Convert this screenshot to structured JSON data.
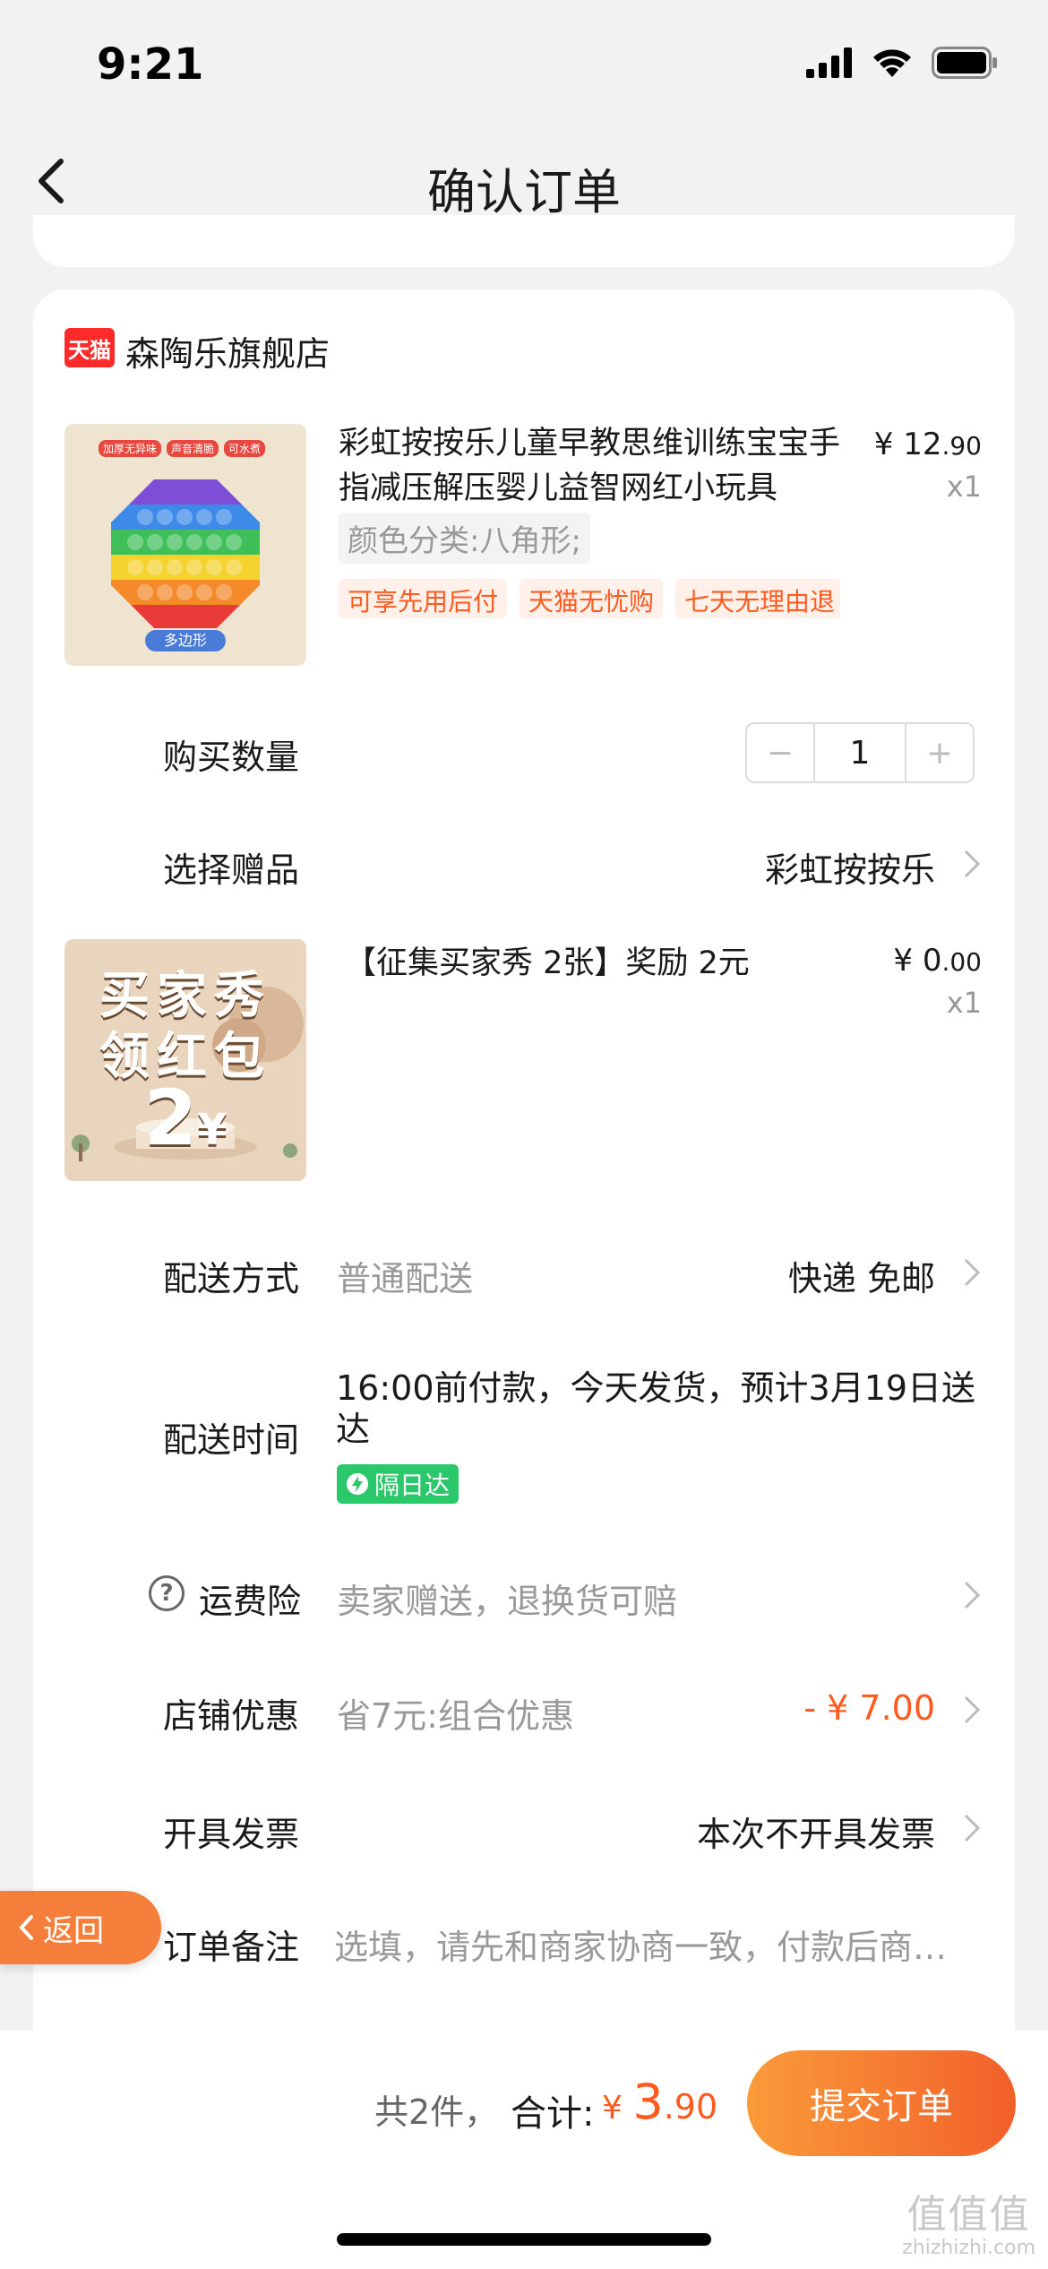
{
  "status": {
    "time": "9:21"
  },
  "nav": {
    "title": "确认订单"
  },
  "shop": {
    "logo_text": "天猫",
    "name": "森陶乐旗舰店"
  },
  "product": {
    "title": "彩虹按按乐儿童早教思维训练宝宝手指减压解压婴儿益智网红小玩具",
    "price_currency": "¥ ",
    "price_main": "12",
    "price_decimal": ".90",
    "qty": "x1",
    "variant": "颜色分类:八角形;",
    "tags": [
      "可享先用后付",
      "天猫无忧购",
      "七天无理由退"
    ],
    "image_labels": [
      "加厚无异味",
      "声音清脆",
      "可水煮"
    ],
    "image_caption": "多边形"
  },
  "quantity": {
    "label": "购买数量",
    "minus": "−",
    "value": "1",
    "plus": "+"
  },
  "gift_select": {
    "label": "选择赠品",
    "value": "彩虹按按乐"
  },
  "gift": {
    "title": "【征集买家秀 2张】奖励 2元",
    "price_currency": "¥ ",
    "price_main": "0",
    "price_decimal": ".00",
    "qty": "x1",
    "image_line1": "买家秀",
    "image_line2": "领红包",
    "image_amount": "2",
    "image_yen": "¥"
  },
  "delivery": {
    "label": "配送方式",
    "sub": "普通配送",
    "value": "快递 免邮"
  },
  "delivery_time": {
    "label": "配送时间",
    "text": "16:00前付款，今天发货，预计3月19日送达",
    "badge": "隔日达"
  },
  "insurance": {
    "label": "运费险",
    "sub": "卖家赠送，退换货可赔"
  },
  "shop_discount": {
    "label": "店铺优惠",
    "sub": "省7元:组合优惠",
    "amount": "- ¥ 7.00"
  },
  "invoice": {
    "label": "开具发票",
    "value": "本次不开具发票"
  },
  "remark": {
    "label": "订单备注",
    "placeholder": "选填，请先和商家协商一致，付款后商…"
  },
  "back_float": {
    "label": "返回"
  },
  "bottom": {
    "count": "共2件，",
    "total_label": "合计:",
    "currency": "¥ ",
    "total_main": "3",
    "total_decimal": ".90",
    "submit": "提交订单"
  },
  "watermark": {
    "main": "值值值",
    "sub": "zhizhizhi.com"
  }
}
